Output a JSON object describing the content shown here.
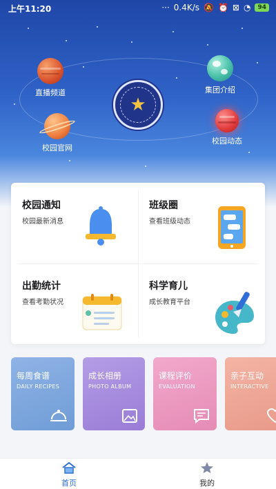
{
  "status_bar": {
    "time": "上午11:20",
    "network_speed": "0.4K/s",
    "battery": "94"
  },
  "hero": {
    "planets": {
      "live": "直播频道",
      "group": "集团介绍",
      "website": "校园官网",
      "news": "校园动态"
    }
  },
  "features": [
    {
      "title": "校园通知",
      "subtitle": "校园最新消息",
      "icon": "bell-icon"
    },
    {
      "title": "班级圈",
      "subtitle": "查看班级动态",
      "icon": "phone-chat-icon"
    },
    {
      "title": "出勤统计",
      "subtitle": "查看考勤状况",
      "icon": "calendar-icon"
    },
    {
      "title": "科学育儿",
      "subtitle": "成长教育平台",
      "icon": "palette-icon"
    }
  ],
  "quick_links": [
    {
      "title": "每周食谱",
      "subtitle": "DAILY RECIPES",
      "icon": "dish-icon",
      "color": "#6f9cd6"
    },
    {
      "title": "成长相册",
      "subtitle": "PHOTO ALBUM",
      "icon": "photo-icon",
      "color": "#9a7cd6"
    },
    {
      "title": "课程评价",
      "subtitle": "EVALUATION",
      "icon": "comment-icon",
      "color": "#e58bb5"
    },
    {
      "title": "亲子互动",
      "subtitle": "INTERACTIVE",
      "icon": "heart-icon",
      "color": "#e89a8a"
    }
  ],
  "tabs": [
    {
      "label": "首页",
      "icon": "home-icon",
      "active": true,
      "color": "#2f6fd6"
    },
    {
      "label": "我的",
      "icon": "profile-star-icon",
      "active": false,
      "color": "#333333"
    }
  ]
}
